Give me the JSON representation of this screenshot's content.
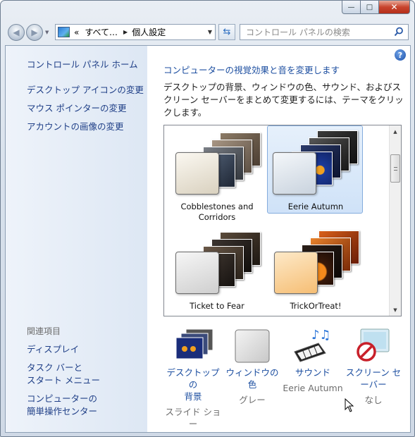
{
  "window": {
    "buttons": {
      "minimize": "—",
      "maximize": "□",
      "close": "✕"
    }
  },
  "navbar": {
    "breadcrumbs": [
      "«",
      "すべて…",
      "個人設定"
    ],
    "search_placeholder": "コントロール パネルの検索",
    "icons": {
      "back": "back-arrow-icon",
      "forward": "forward-arrow-icon",
      "refresh": "refresh-icon",
      "search": "search-icon",
      "control_panel": "control-panel-icon"
    }
  },
  "sidebar": {
    "home": "コントロール パネル ホーム",
    "links": [
      "デスクトップ アイコンの変更",
      "マウス ポインターの変更",
      "アカウントの画像の変更"
    ],
    "related_heading": "関連項目",
    "related": [
      {
        "line1": "ディスプレイ",
        "line2": ""
      },
      {
        "line1": "タスク バーと",
        "line2": "スタート メニュー"
      },
      {
        "line1": "コンピューターの",
        "line2": "簡単操作センター"
      }
    ]
  },
  "main": {
    "title": "コンピューターの視覚効果と音を変更します",
    "description": "デスクトップの背景、ウィンドウの色、サウンド、およびスクリーン セーバーをまとめて変更するには、テーマをクリックします。",
    "themes": [
      {
        "name_line1": "Cobblestones and",
        "name_line2": "Corridors",
        "selected": false,
        "swatch": "#efe9dc"
      },
      {
        "name_line1": "Eerie Autumn",
        "name_line2": "",
        "selected": true,
        "swatch": "#e5ebf2"
      },
      {
        "name_line1": "Ticket to Fear",
        "name_line2": "",
        "selected": false,
        "swatch": "#e6e6e6"
      },
      {
        "name_line1": "TrickOrTreat!",
        "name_line2": "",
        "selected": false,
        "swatch": "#fbd9a4"
      }
    ]
  },
  "settings": [
    {
      "label_line1": "デスクトップの",
      "label_line2": "背景",
      "value_line1": "スライド ショ",
      "value_line2": "ー",
      "icon": "desktop-background-icon"
    },
    {
      "label_line1": "ウィンドウの色",
      "label_line2": "",
      "value_line1": "グレー",
      "value_line2": "",
      "icon": "window-color-icon"
    },
    {
      "label_line1": "サウンド",
      "label_line2": "",
      "value_line1": "Eerie Autumn",
      "value_line2": "",
      "icon": "sound-icon"
    },
    {
      "label_line1": "スクリーン セ",
      "label_line2": "ーバー",
      "value_line1": "なし",
      "value_line2": "",
      "icon": "screensaver-icon"
    }
  ],
  "colors": {
    "link": "#1c4ea0",
    "selected_bg": "#cfe2f8",
    "selected_border": "#84acdd"
  }
}
